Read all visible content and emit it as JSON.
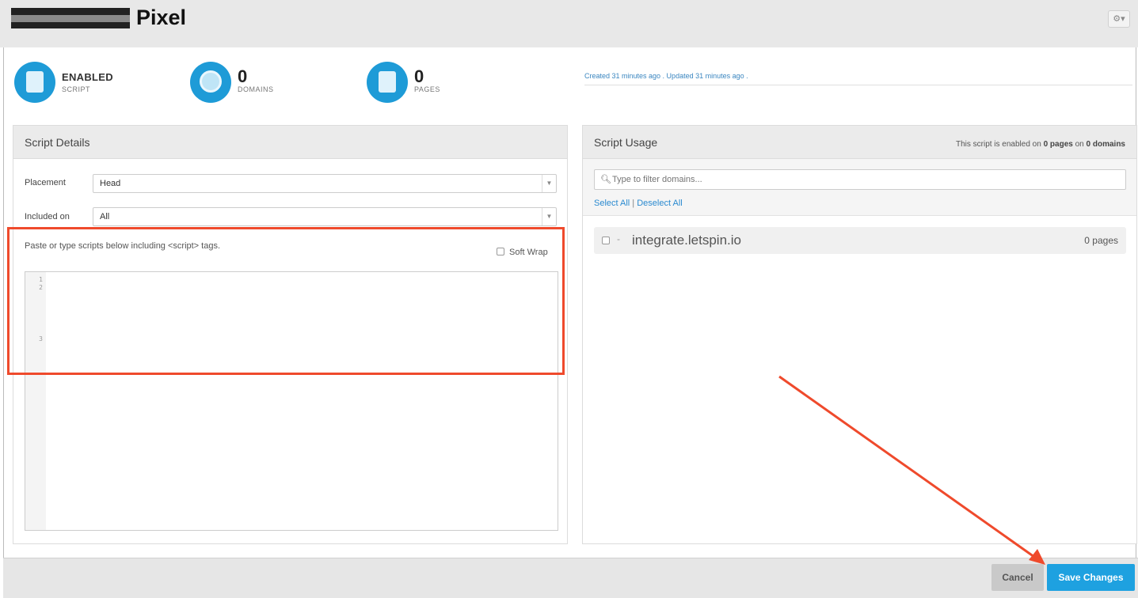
{
  "header": {
    "title": "Pixel",
    "settings_icon": "gear-icon",
    "settings_glyph": "⚙▾"
  },
  "stats": [
    {
      "value": "ENABLED",
      "label": "SCRIPT",
      "icon": "script-scroll-icon"
    },
    {
      "value": "0",
      "label": "DOMAINS",
      "icon": "globe-icon"
    },
    {
      "value": "0",
      "label": "PAGES",
      "icon": "pages-icon"
    }
  ],
  "meta": {
    "created_updated": "Created 31 minutes ago . Updated 31 minutes ago ."
  },
  "script_details": {
    "title": "Script Details",
    "placement_label": "Placement",
    "placement_value": "Head",
    "included_label": "Included on",
    "included_value": "All",
    "hint": "Paste or type scripts below including <script> tags.",
    "soft_wrap_label": "Soft Wrap",
    "line_numbers": [
      "1",
      "2",
      "3"
    ]
  },
  "script_usage": {
    "title": "Script Usage",
    "note_prefix": "This script is enabled on ",
    "note_pages": "0 pages",
    "note_mid": " on ",
    "note_domains": "0 domains",
    "filter_placeholder": "Type to filter domains...",
    "select_all": "Select All",
    "separator": " | ",
    "deselect_all": "Deselect All",
    "domains": [
      {
        "name": "integrate.letspin.io",
        "count": "0 pages",
        "prefix": "-"
      }
    ]
  },
  "footer": {
    "cancel_label": "Cancel",
    "save_label": "Save Changes"
  },
  "colors": {
    "accent": "#1ea1e0",
    "annotation": "#ef4a2c"
  }
}
